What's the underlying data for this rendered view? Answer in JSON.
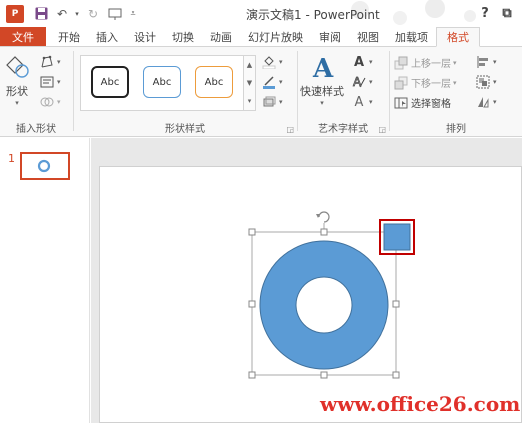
{
  "window": {
    "title": "演示文稿1 - PowerPoint",
    "app_logo_text": "P",
    "help_label": "?",
    "restore_label": "⧉"
  },
  "tabs": [
    {
      "label": "文件",
      "kind": "file"
    },
    {
      "label": "开始"
    },
    {
      "label": "插入"
    },
    {
      "label": "设计"
    },
    {
      "label": "切换"
    },
    {
      "label": "动画"
    },
    {
      "label": "幻灯片放映"
    },
    {
      "label": "审阅"
    },
    {
      "label": "视图"
    },
    {
      "label": "加载项"
    },
    {
      "label": "格式",
      "kind": "active"
    }
  ],
  "ribbon": {
    "insert_shapes": {
      "shape_button_label": "形状",
      "group_label": "插入形状"
    },
    "shape_styles": {
      "gallery": [
        "Abc",
        "Abc",
        "Abc"
      ],
      "group_label": "形状样式"
    },
    "wordart": {
      "quick_styles_label": "快速样式",
      "group_label": "艺术字样式"
    },
    "arrange": {
      "bring_forward": "上移一层",
      "send_backward": "下移一层",
      "selection_pane": "选择窗格",
      "group_label": "排列"
    }
  },
  "slides": {
    "current_number": "1"
  },
  "watermark": "www.office26.com",
  "colors": {
    "accent": "#d24726",
    "shape_fill": "#5b9bd5",
    "callout_border": "#c00000"
  }
}
